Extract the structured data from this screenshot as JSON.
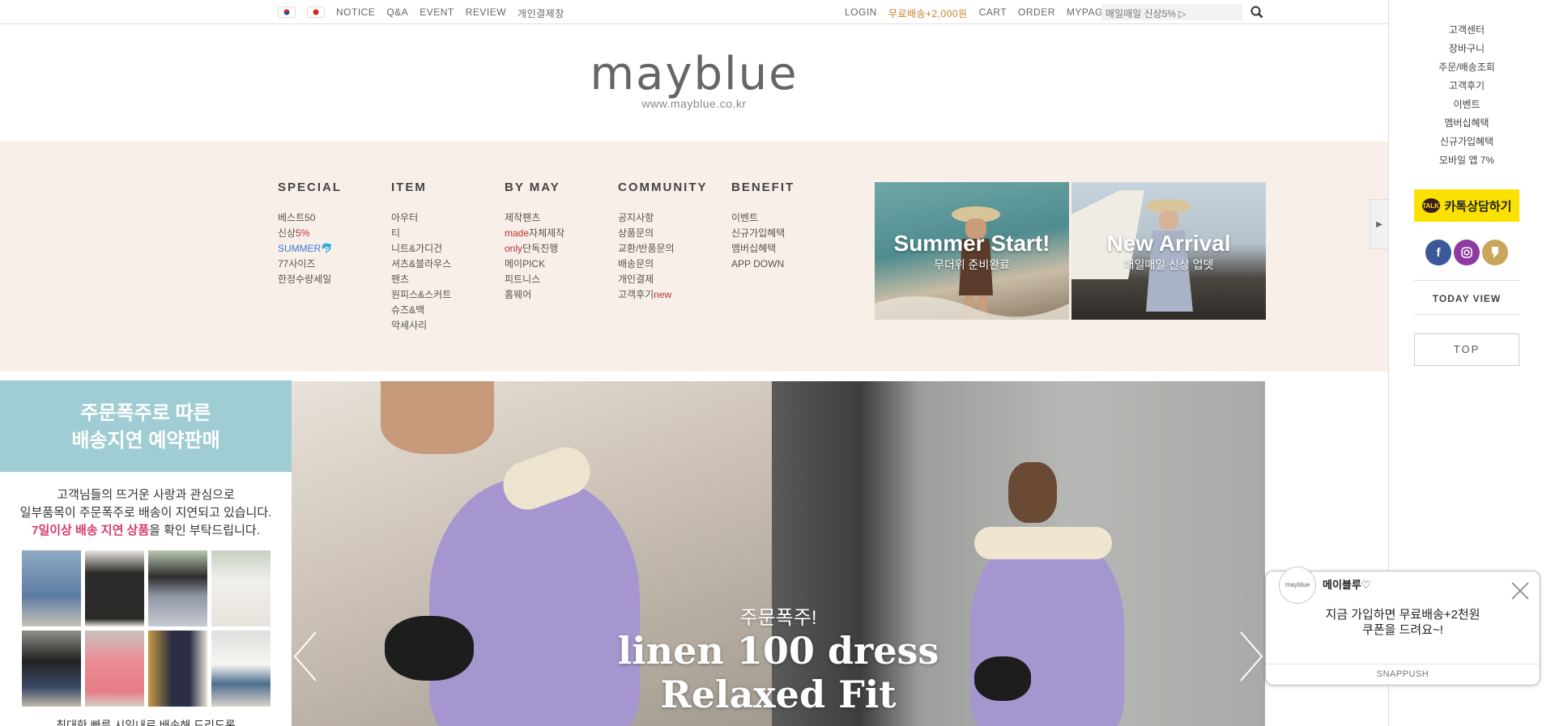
{
  "topbar": {
    "nav_left": [
      "NOTICE",
      "Q&A",
      "EVENT",
      "REVIEW",
      "개인결제창"
    ],
    "nav_right": [
      "LOGIN",
      "무료배송+2,000원",
      "CART",
      "ORDER",
      "MYPAGE"
    ],
    "search_placeholder": "매일매일 신상5% ▷"
  },
  "logo": {
    "name": "mayblue",
    "url": "www.mayblue.co.kr"
  },
  "menu": {
    "special": {
      "title": "SPECIAL",
      "items": [
        "베스트50",
        "신상",
        "5%",
        "SUMMER🐬",
        "77사이즈",
        "한정수량세일"
      ]
    },
    "item": {
      "title": "ITEM",
      "items": [
        "아우터",
        "티",
        "니트&가디건",
        "셔츠&블라우스",
        "팬츠",
        "원피스&스커트",
        "슈즈&백",
        "악세사리"
      ]
    },
    "bymay": {
      "title": "BY MAY",
      "items": [
        "제작팬츠",
        "made",
        "자체제작",
        "only",
        "단독진행",
        "메이PICK",
        "피트니스",
        "홈웨어"
      ]
    },
    "community": {
      "title": "COMMUNITY",
      "items": [
        "공지사항",
        "상품문의",
        "교환/반품문의",
        "배송문의",
        "개인결제",
        "고객후기",
        "new"
      ]
    },
    "benefit": {
      "title": "BENEFIT",
      "items": [
        "이벤트",
        "신규가입혜택",
        "멤버십혜택",
        "APP DOWN"
      ]
    }
  },
  "banners": [
    {
      "title": "Summer Start!",
      "subtitle": "무더위 준비완료"
    },
    {
      "title": "New Arrival",
      "subtitle": "매일매일 신상 업뎃"
    }
  ],
  "notice": {
    "head1": "주문폭주로 따른",
    "head2": "배송지연 예약판매",
    "line1": "고객님들의 뜨거운 사랑과 관심으로",
    "line2": "일부품목이 주문폭주로 배송이 지연되고 있습니다.",
    "line3_pink": "7일이상 배송 지연 상품",
    "line3_rest": "을 확인 부탁드립니다.",
    "foot": "최대한 빠른 시일내로 배송해 드리도록"
  },
  "hero": {
    "sub": "주문폭주!",
    "line1": "linen 100 dress",
    "line2": "Relaxed Fit"
  },
  "sidebar": {
    "links": [
      "고객센터",
      "장바구니",
      "주문/배송조회",
      "고객후기",
      "이벤트",
      "멤버십혜택",
      "신규가입혜택",
      "모바일 앱 7%"
    ],
    "kakao": "카톡상담하기",
    "kakao_badge": "TALK",
    "today": "TODAY VIEW",
    "top": "TOP"
  },
  "popup": {
    "avatar": "mayblue",
    "title": "메이블루♡",
    "msg1": "지금 가입하면 무료배송+2천원",
    "msg2": "쿠폰을 드려요~!",
    "brand": "SNAPPUSH"
  },
  "colors": {
    "menu_bg": "#f8efe8",
    "notice_head": "#9fcdd3",
    "kakao": "#fae100",
    "accent_red": "#b33",
    "promo_orange": "#c8822a"
  }
}
